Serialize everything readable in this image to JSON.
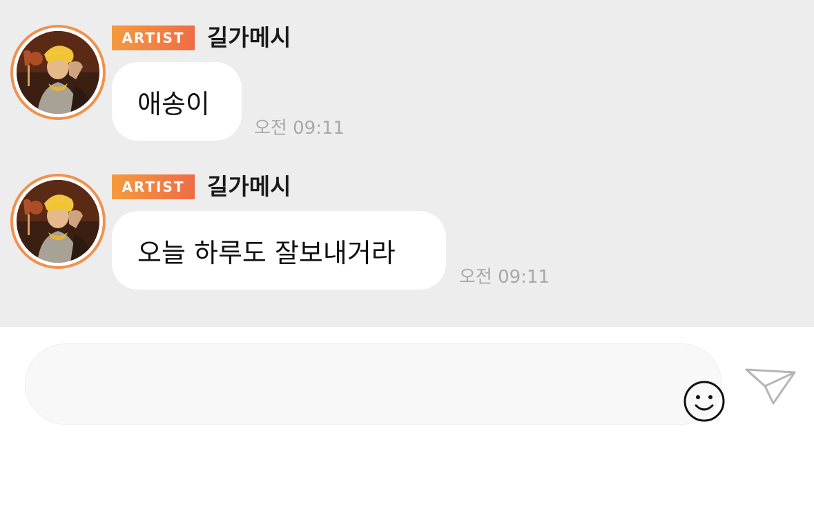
{
  "messages": [
    {
      "badge": "ARTIST",
      "sender": "길가메시",
      "text": "애송이",
      "time": "오전 09:11"
    },
    {
      "badge": "ARTIST",
      "sender": "길가메시",
      "text": "오늘 하루도 잘보내거라",
      "time": "오전 09:11"
    }
  ],
  "composer": {
    "placeholder": "",
    "emoji_icon": "smiley-icon",
    "send_icon": "paper-plane-icon"
  },
  "colors": {
    "chat_background": "#ededed",
    "badge_gradient_start": "#f59a3e",
    "badge_gradient_end": "#ee6c45",
    "avatar_ring": "#f0914e",
    "timestamp": "#a8a8a8"
  }
}
